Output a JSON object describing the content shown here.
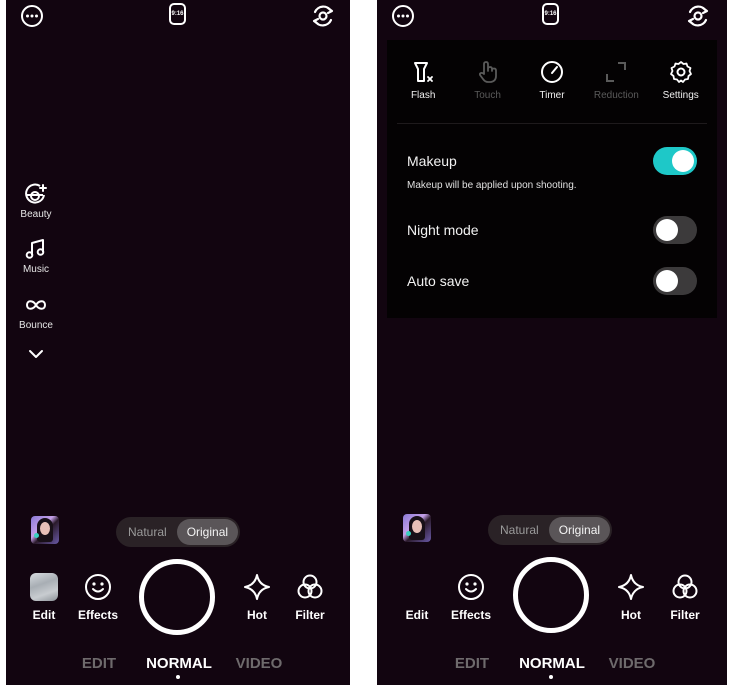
{
  "left_screen": {
    "top_bar": {
      "more_icon": "more-horizontal-icon",
      "aspect_ratio": "9:16",
      "flip_icon": "camera-flip-icon"
    },
    "side_tools": [
      {
        "label": "Beauty",
        "icon": "beauty-face-icon"
      },
      {
        "label": "Music",
        "icon": "music-note-icon"
      },
      {
        "label": "Bounce",
        "icon": "infinity-loop-icon"
      }
    ],
    "expand_icon": "chevron-down-icon",
    "beauty_mode": {
      "options": [
        "Natural",
        "Original"
      ],
      "selected": "Original"
    },
    "bottom_tools": {
      "edit": "Edit",
      "effects": "Effects",
      "hot": "Hot",
      "filter": "Filter"
    },
    "modes": {
      "items": [
        "EDIT",
        "NORMAL",
        "VIDEO"
      ],
      "selected": "NORMAL"
    }
  },
  "right_screen": {
    "top_bar": {
      "more_icon": "more-horizontal-icon",
      "aspect_ratio": "9:16",
      "flip_icon": "camera-flip-icon"
    },
    "settings_panel": {
      "quick_options": [
        {
          "label": "Flash",
          "icon": "flash-off-icon",
          "enabled": true
        },
        {
          "label": "Touch",
          "icon": "touch-hand-icon",
          "enabled": false
        },
        {
          "label": "Timer",
          "icon": "timer-icon",
          "enabled": true
        },
        {
          "label": "Reduction",
          "icon": "reduction-icon",
          "enabled": false
        },
        {
          "label": "Settings",
          "icon": "gear-icon",
          "enabled": true
        }
      ],
      "toggles": [
        {
          "label": "Makeup",
          "on": true,
          "description": "Makeup will be applied upon shooting."
        },
        {
          "label": "Night mode",
          "on": false
        },
        {
          "label": "Auto save",
          "on": false
        }
      ],
      "accent_color": "#1ec8c8"
    },
    "beauty_mode": {
      "options": [
        "Natural",
        "Original"
      ],
      "selected": "Original"
    },
    "bottom_tools": {
      "edit": "Edit",
      "effects": "Effects",
      "hot": "Hot",
      "filter": "Filter"
    },
    "modes": {
      "items": [
        "EDIT",
        "NORMAL",
        "VIDEO"
      ],
      "selected": "NORMAL"
    }
  }
}
